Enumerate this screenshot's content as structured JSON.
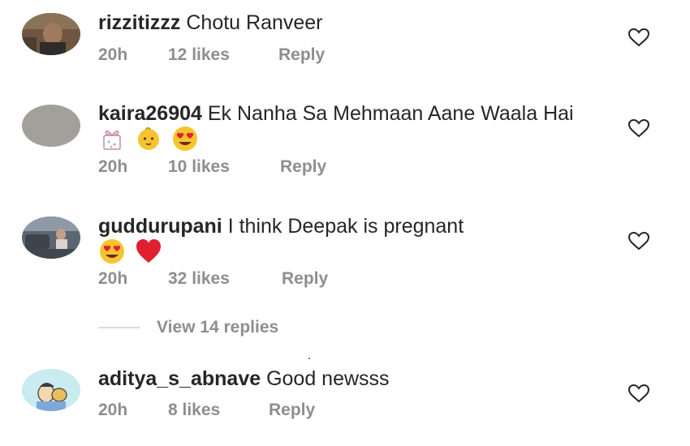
{
  "comments": [
    {
      "username": "rizzitizzz",
      "text": "Chotu Ranveer",
      "time": "20h",
      "likes": "12 likes",
      "reply": "Reply"
    },
    {
      "username": "kaira26904",
      "text": "Ek Nanha Sa Mehmaan Aane Waala Hai",
      "emojis": [
        "gift-emoji",
        "baby-emoji",
        "heart-eyes-emoji"
      ],
      "time": "20h",
      "likes": "10 likes",
      "reply": "Reply"
    },
    {
      "username": "guddurupani",
      "text": "I think Deepak is pregnant",
      "emojis": [
        "heart-eyes-emoji",
        "red-heart-emoji"
      ],
      "time": "20h",
      "likes": "32 likes",
      "reply": "Reply",
      "view_replies": "View 14 replies"
    },
    {
      "username": "aditya_s_abnave",
      "text": "Good newsss",
      "time": "20h",
      "likes": "8 likes",
      "reply": "Reply"
    }
  ],
  "colors": {
    "text": "#262626",
    "meta": "#8e8e8e",
    "divider": "#dbdbdb",
    "heart_emoji": "#e0202f",
    "face_emoji": "#f7c42f"
  }
}
